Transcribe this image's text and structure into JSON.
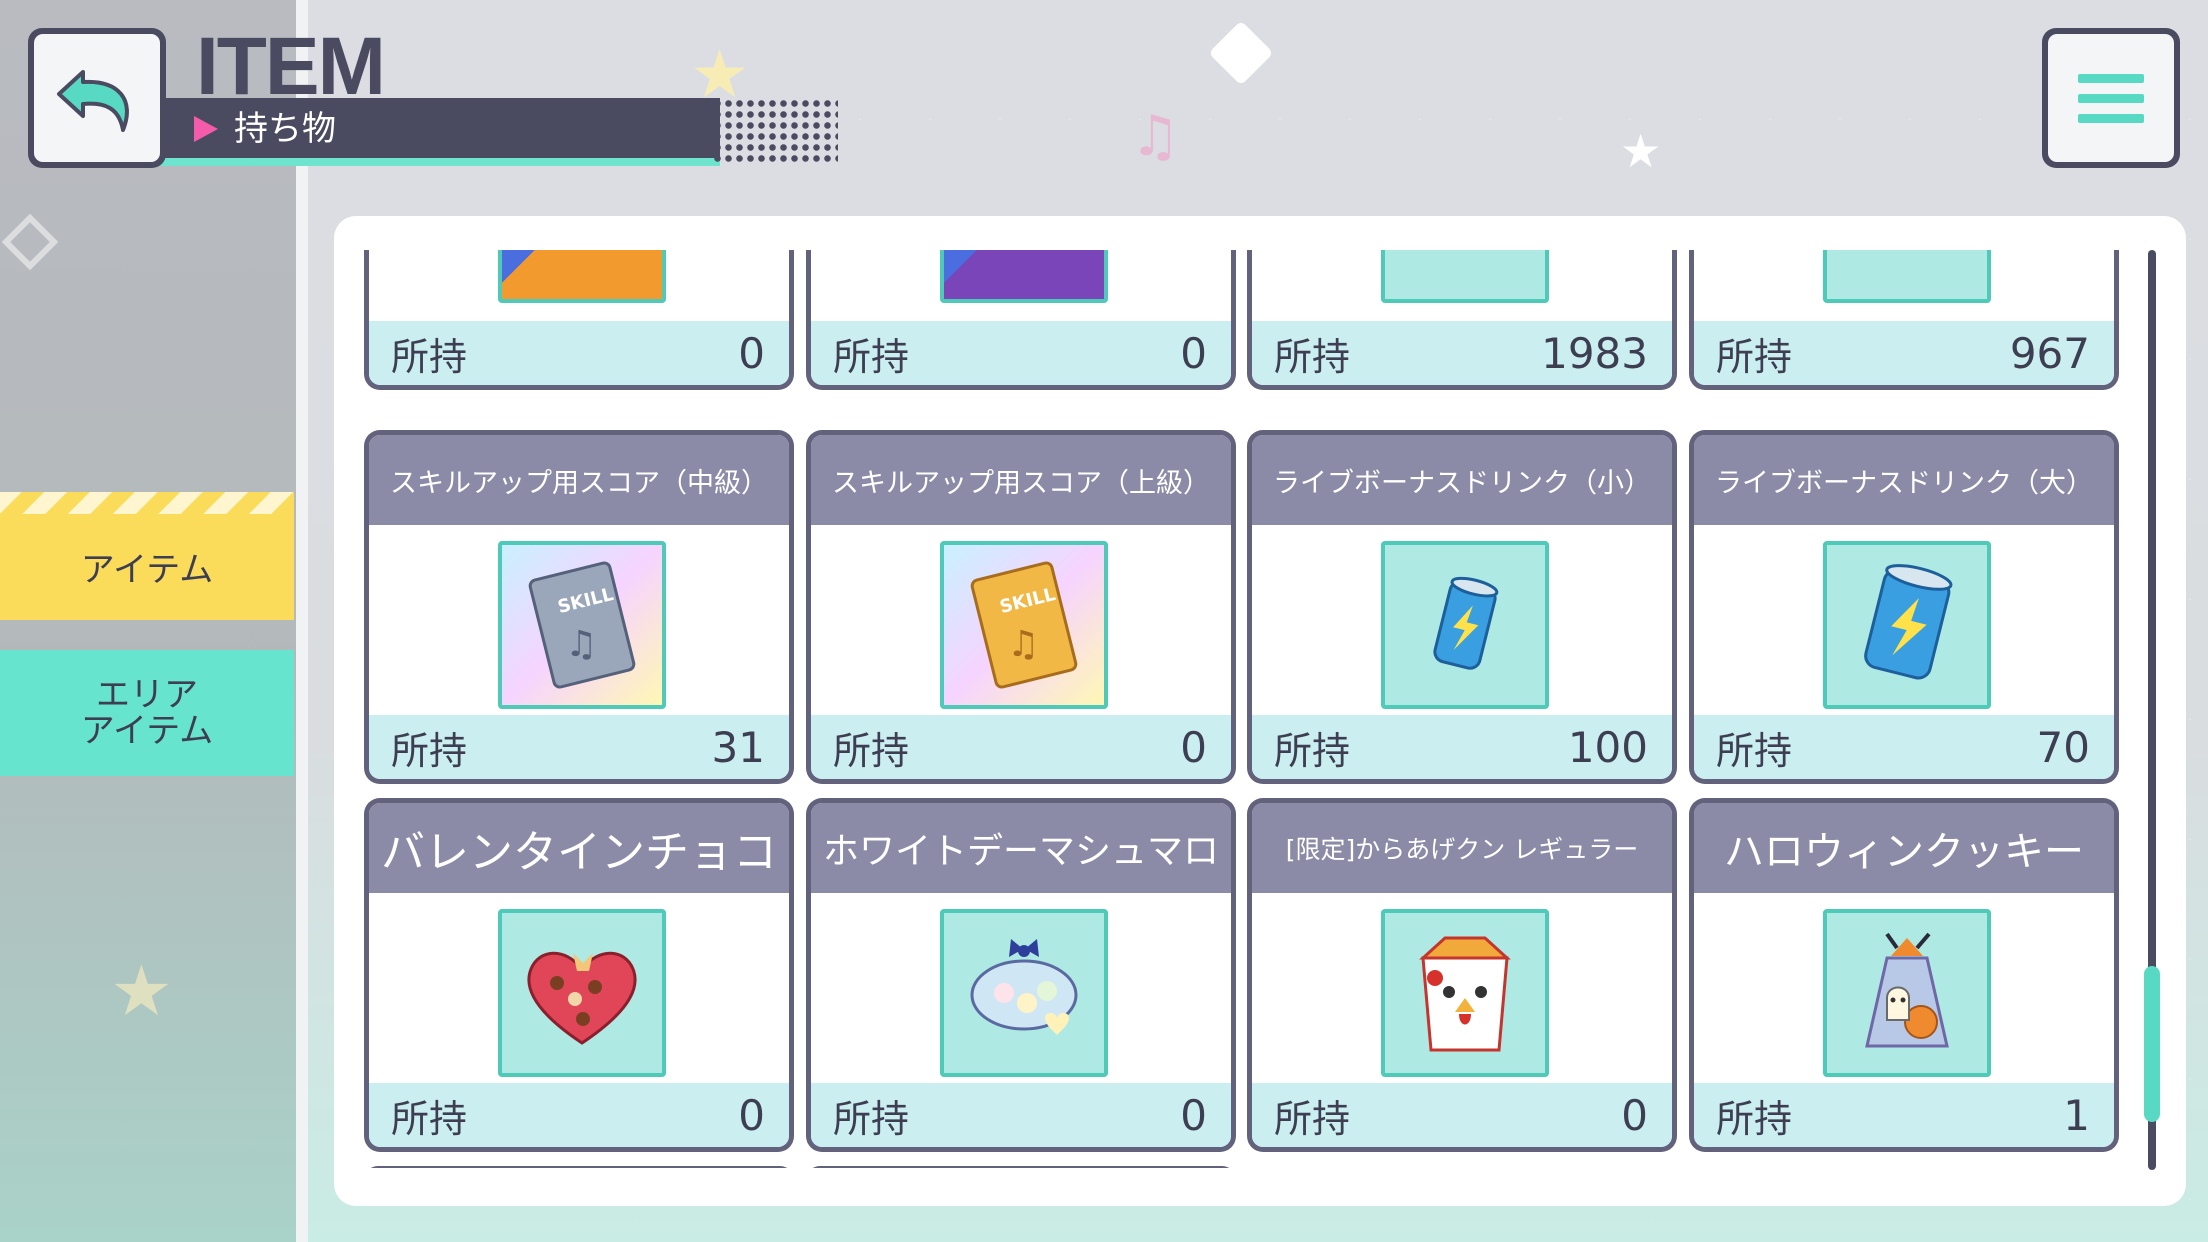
{
  "header": {
    "title": "ITEM",
    "subtitle": "持ち物"
  },
  "sidebar": {
    "tabs": [
      {
        "label": "アイテム",
        "active": true
      },
      {
        "label": "エリア\nアイテム",
        "active": false
      }
    ]
  },
  "inventory": {
    "own_label": "所持",
    "rows": [
      [
        {
          "name": "",
          "count": "0",
          "icon": "music-card-icon"
        },
        {
          "name": "",
          "count": "0",
          "icon": "music-card-icon"
        },
        {
          "name": "",
          "count": "1983",
          "icon": "sheet-music-icon"
        },
        {
          "name": "",
          "count": "967",
          "icon": "sheet-music-icon"
        }
      ],
      [
        {
          "name": "スキルアップ用スコア（中級）",
          "count": "31",
          "icon": "skill-score-silver-icon"
        },
        {
          "name": "スキルアップ用スコア（上級）",
          "count": "0",
          "icon": "skill-score-gold-icon"
        },
        {
          "name": "ライブボーナスドリンク（小）",
          "count": "100",
          "icon": "energy-drink-small-icon"
        },
        {
          "name": "ライブボーナスドリンク（大）",
          "count": "70",
          "icon": "energy-drink-large-icon"
        }
      ],
      [
        {
          "name": "バレンタインチョコ",
          "count": "0",
          "icon": "chocolate-box-icon"
        },
        {
          "name": "ホワイトデーマシュマロ",
          "count": "0",
          "icon": "marshmallow-box-icon"
        },
        {
          "name": "[限定]からあげクン レギュラー",
          "count": "0",
          "icon": "karaage-box-icon"
        },
        {
          "name": "ハロウィンクッキー",
          "count": "1",
          "icon": "halloween-cookie-icon"
        }
      ]
    ]
  },
  "colors": {
    "dark": "#4a4b60",
    "accent_teal": "#67e4cd",
    "accent_yellow": "#fbdc5a",
    "accent_pink": "#f45cab",
    "card_header": "#8b8ba8"
  }
}
